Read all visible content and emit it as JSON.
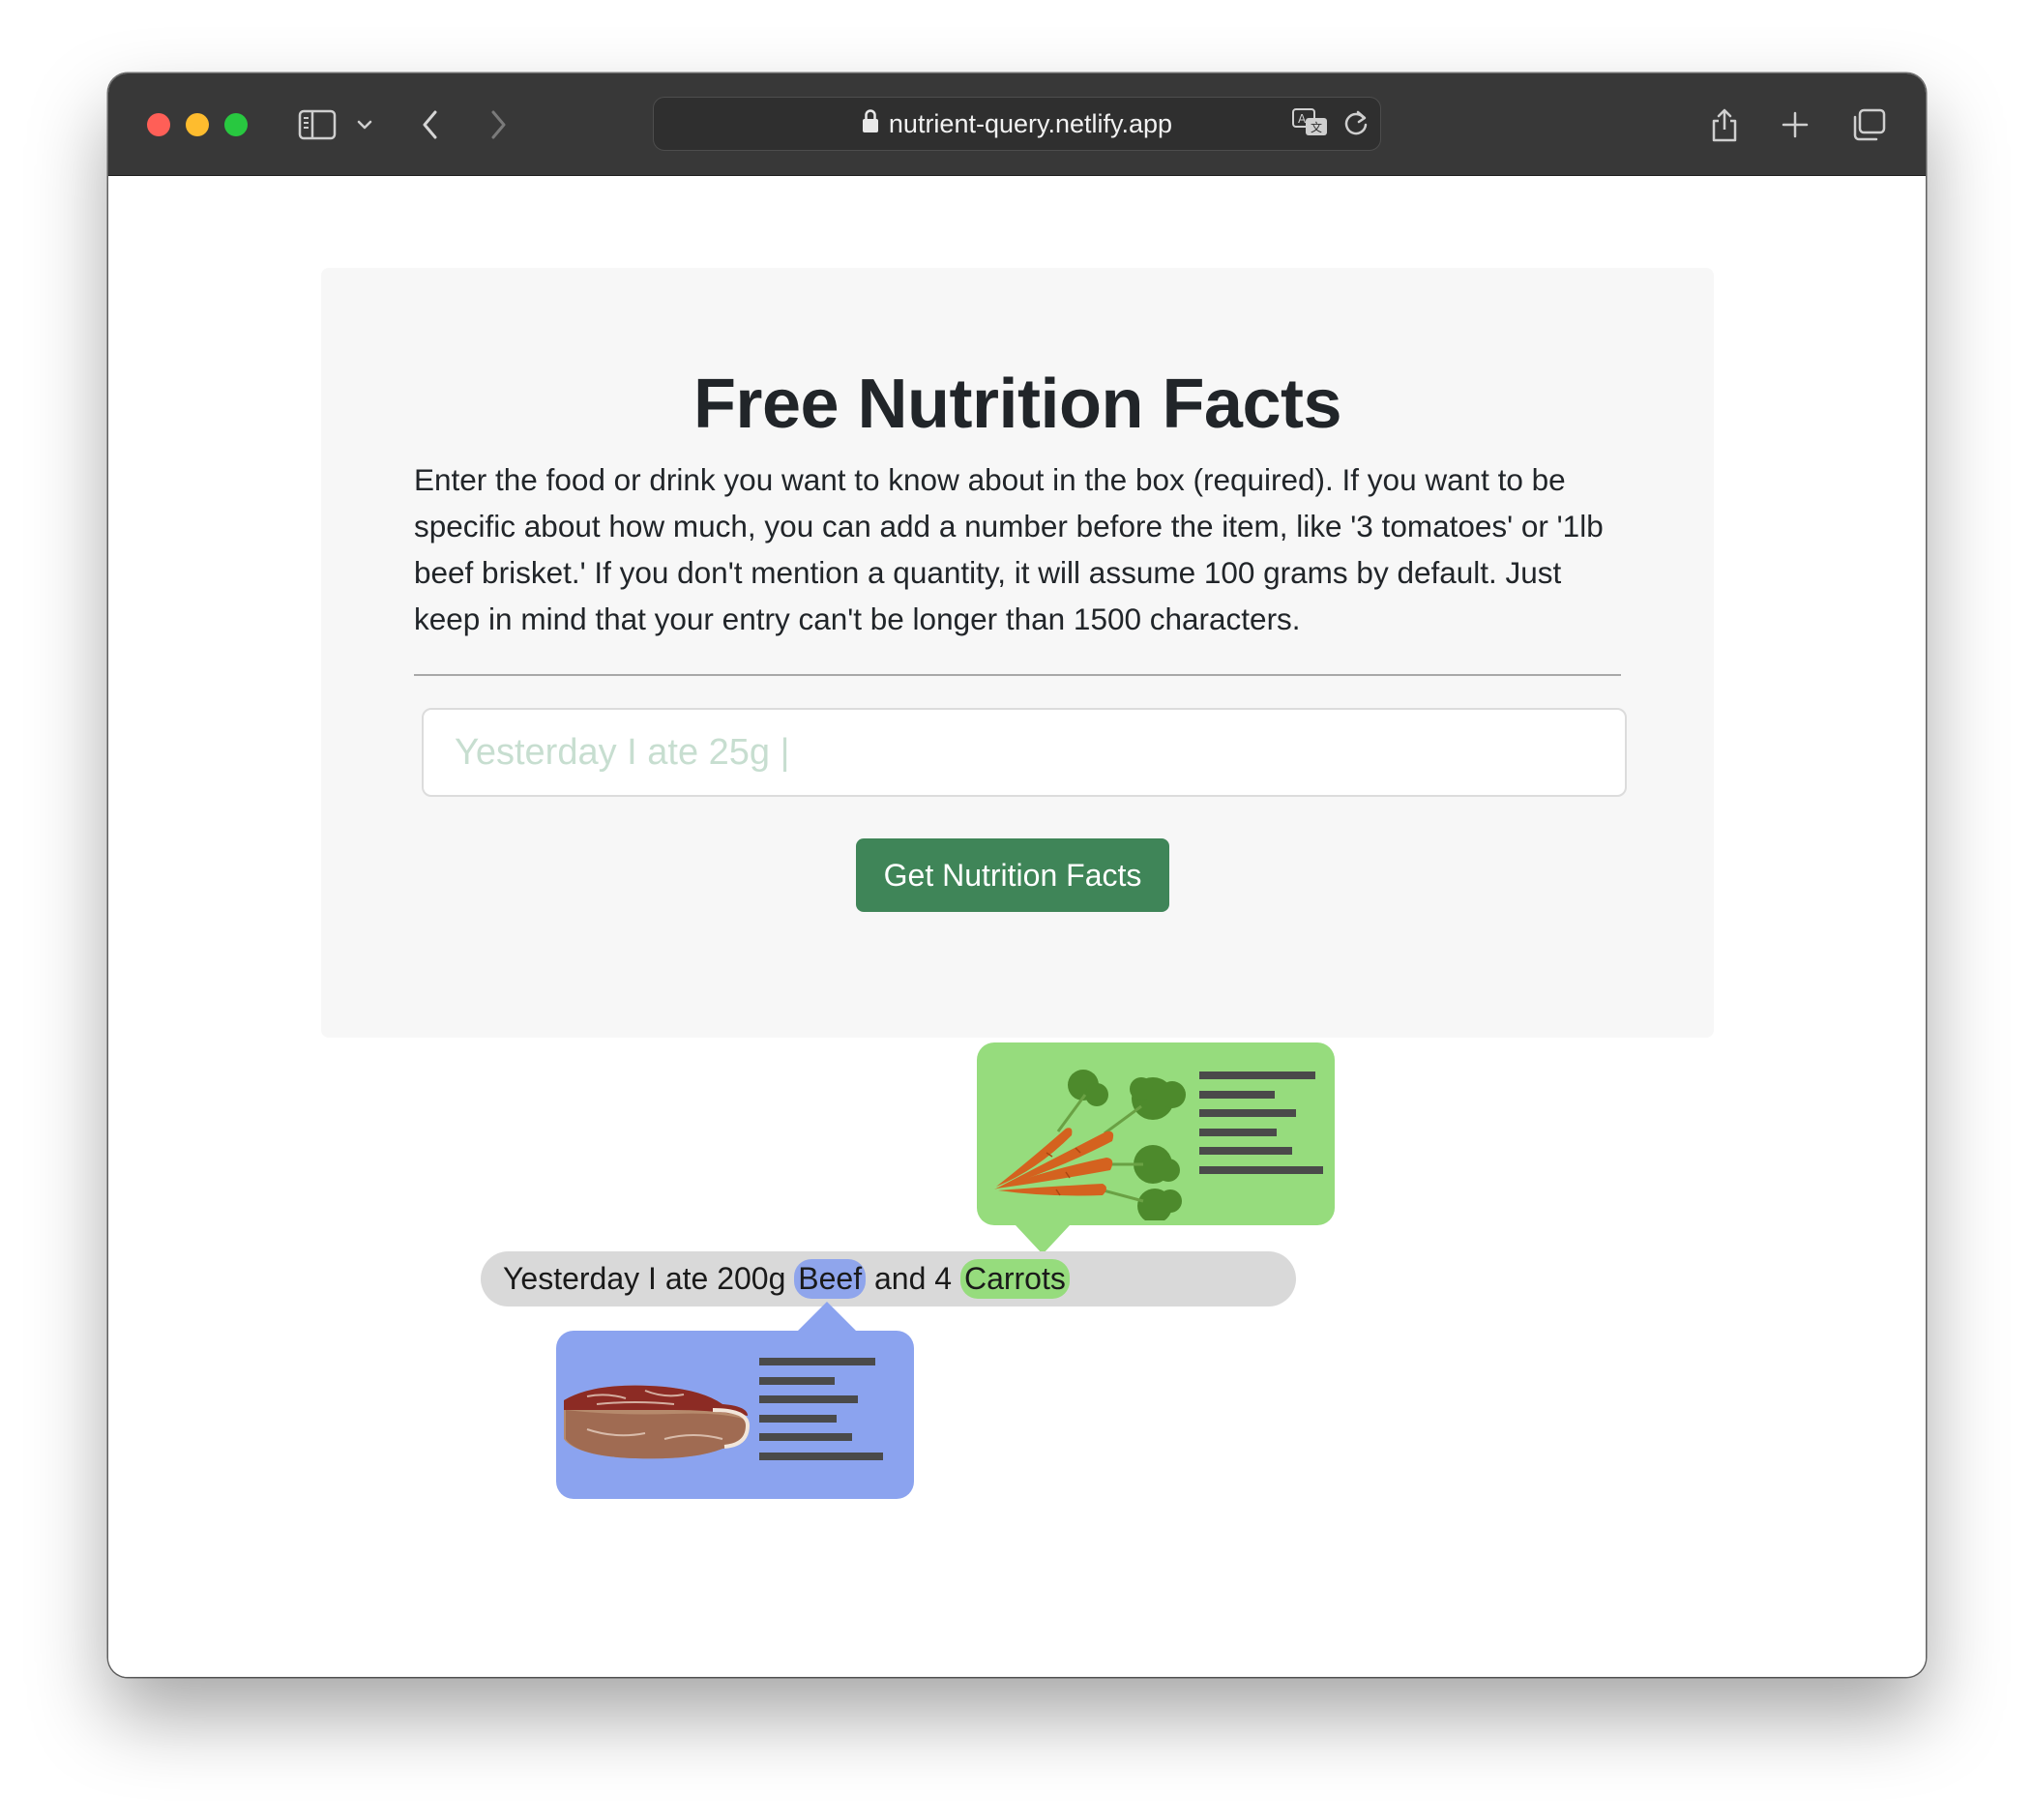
{
  "browser": {
    "url": "nutrient-query.netlify.app"
  },
  "card": {
    "title": "Free Nutrition Facts",
    "description": "Enter the food or drink you want to know about in the box (required). If you want to be specific about how much, you can add a number before the item, like '3 tomatoes' or '1lb beef brisket.' If you don't mention a quantity, it will assume 100 grams by default. Just keep in mind that your entry can't be longer than 1500 characters.",
    "query_placeholder": "Yesterday I ate 25g |",
    "button_label": "Get Nutrition Facts"
  },
  "illustration": {
    "sentence_prefix": "Yesterday I ate 200g ",
    "food_1": "Beef",
    "sentence_middle": " and 4 ",
    "food_2": "Carrots",
    "food_1_color": "#8ba3ef",
    "food_2_color": "#96dc7d"
  }
}
